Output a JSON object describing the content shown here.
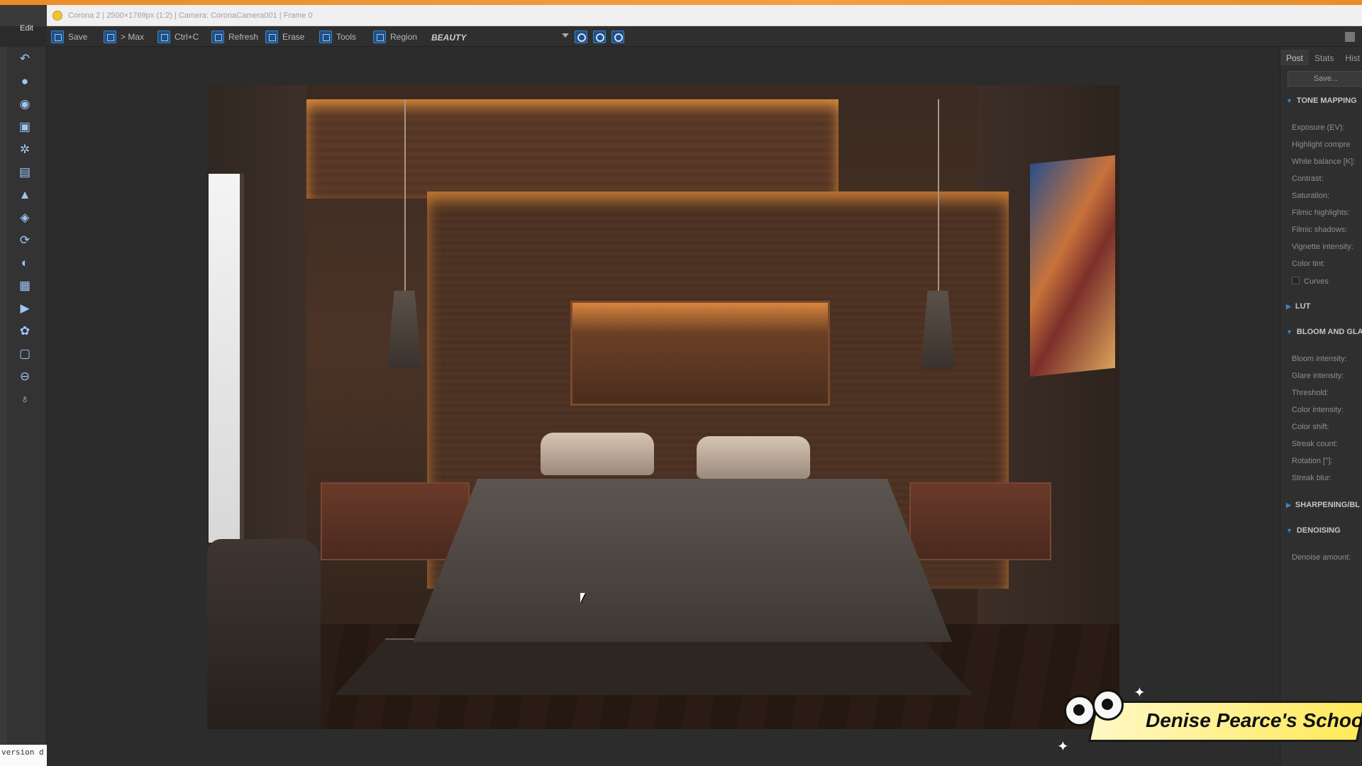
{
  "window": {
    "title": "Corona 2 | 2500×1769px (1:2) | Camera: CoronaCamera001 | Frame 0",
    "edit_label": "Edit"
  },
  "toolbar": {
    "save": "Save",
    "max": "> Max",
    "copy": "Ctrl+C",
    "refresh": "Refresh",
    "erase": "Erase",
    "tools": "Tools",
    "region": "Region",
    "pass": "BEAUTY"
  },
  "panel": {
    "tabs": [
      "Post",
      "Stats",
      "Hist"
    ],
    "save_button": "Save...",
    "tone_mapping": {
      "title": "TONE MAPPING",
      "fields": [
        "Exposure (EV):",
        "Highlight compre",
        "White balance [K]:",
        "Contrast:",
        "Saturation:",
        "Filmic highlights:",
        "Filmic shadows:",
        "Vignette intensity:",
        "Color tint:"
      ],
      "curves": "Curves"
    },
    "lut": {
      "title": "LUT"
    },
    "bloom": {
      "title": "BLOOM AND GLA",
      "fields": [
        "Bloom intensity:",
        "Glare intensity:",
        "Threshold:",
        "Color intensity:",
        "Color shift:",
        "Streak count:",
        "Rotation [°]:",
        "Streak blur:"
      ]
    },
    "sharpening": {
      "title": "SHARPENING/BL"
    },
    "denoising": {
      "title": "DENOISING",
      "fields": [
        "Denoise amount:"
      ]
    }
  },
  "console": {
    "text": "version d"
  },
  "watermark": {
    "text": "Denise Pearce's School"
  }
}
